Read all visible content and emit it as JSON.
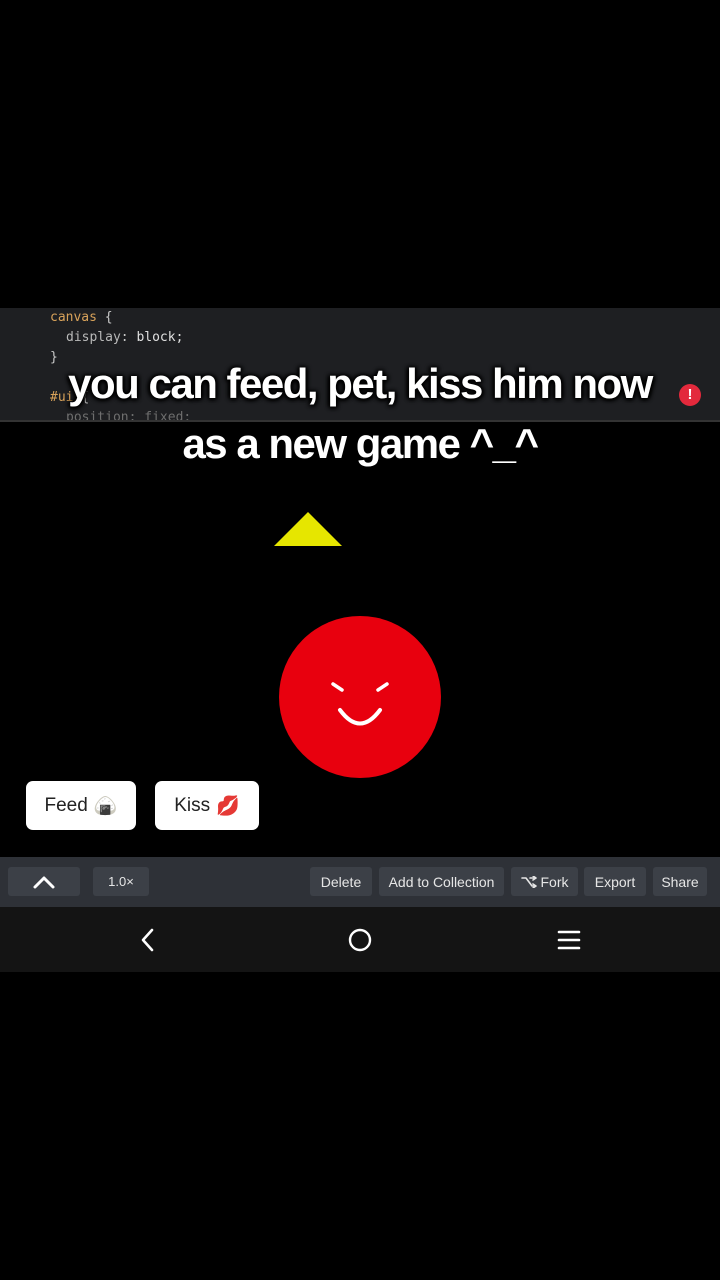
{
  "code": {
    "lines": [
      {
        "selector": "canvas",
        "brace": "{"
      },
      {
        "property": "display",
        "value": "block;"
      },
      {
        "close": "}"
      },
      {
        "selector": "#ui",
        "brace": "{"
      },
      {
        "property": "position",
        "value": "fixed;"
      }
    ]
  },
  "caption": {
    "line1": "you can feed, pet, kiss him now",
    "line2": "as a new game ^_^",
    "alert_glyph": "!"
  },
  "game": {
    "pet_color": "#e8000e",
    "triangle_color": "#e6e600",
    "buttons": [
      {
        "label": "Feed",
        "emoji": "🍙"
      },
      {
        "label": "Kiss",
        "emoji": "💋"
      }
    ]
  },
  "toolbar": {
    "collapse_icon": "chevron-up-icon",
    "speed": "1.0×",
    "delete": "Delete",
    "add_to_collection": "Add to Collection",
    "fork": "Fork",
    "fork_icon": "fork-icon",
    "export": "Export",
    "share": "Share"
  },
  "navbar": {
    "icons": [
      "back-icon",
      "home-icon",
      "menu-icon"
    ]
  }
}
